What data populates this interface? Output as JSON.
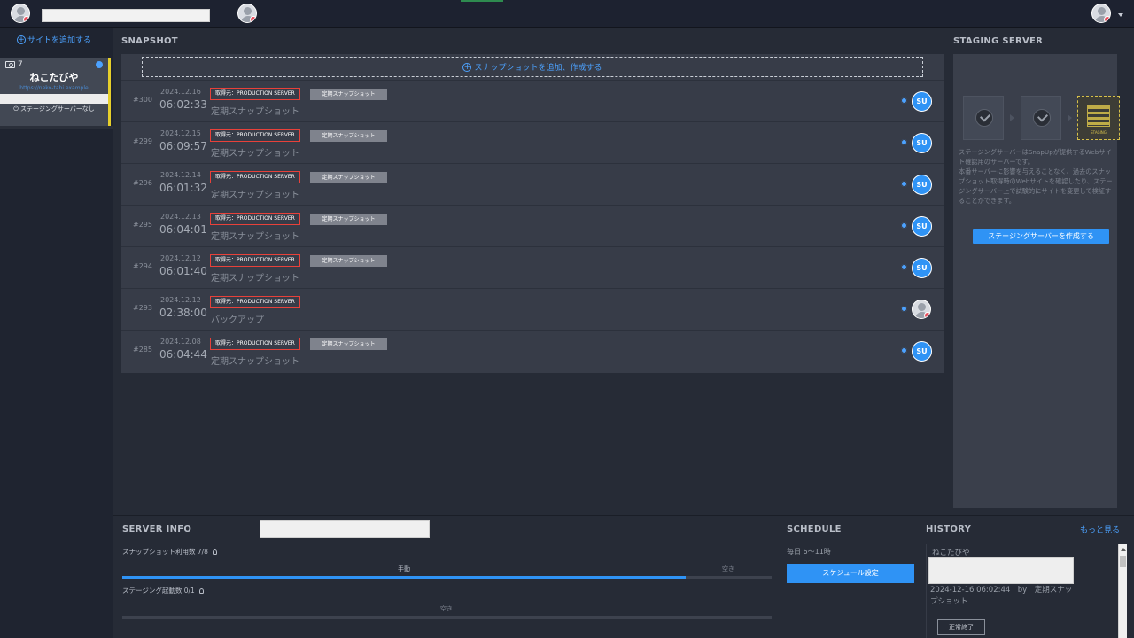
{
  "sidebar": {
    "add_site_label": "サイトを追加する",
    "site": {
      "count": "7",
      "name": "ねこたびや",
      "url": "https://neko-tabi.example",
      "staging_status": "ステージングサーバーなし"
    }
  },
  "snapshot": {
    "title": "SNAPSHOT",
    "add_label": "スナップショットを追加、作成する",
    "rows": [
      {
        "num": "#300",
        "date": "2024.12.16",
        "time": "06:02:33",
        "source": "取得元：PRODUCTION SERVER",
        "type": "定期スナップショット",
        "label": "定期スナップショット",
        "badge": "SU"
      },
      {
        "num": "#299",
        "date": "2024.12.15",
        "time": "06:09:57",
        "source": "取得元：PRODUCTION SERVER",
        "type": "定期スナップショット",
        "label": "定期スナップショット",
        "badge": "SU"
      },
      {
        "num": "#296",
        "date": "2024.12.14",
        "time": "06:01:32",
        "source": "取得元：PRODUCTION SERVER",
        "type": "定期スナップショット",
        "label": "定期スナップショット",
        "badge": "SU"
      },
      {
        "num": "#295",
        "date": "2024.12.13",
        "time": "06:04:01",
        "source": "取得元：PRODUCTION SERVER",
        "type": "定期スナップショット",
        "label": "定期スナップショット",
        "badge": "SU"
      },
      {
        "num": "#294",
        "date": "2024.12.12",
        "time": "06:01:40",
        "source": "取得元：PRODUCTION SERVER",
        "type": "定期スナップショット",
        "label": "定期スナップショット",
        "badge": "SU"
      },
      {
        "num": "#293",
        "date": "2024.12.12",
        "time": "02:38:00",
        "source": "取得元：PRODUCTION SERVER",
        "type": "",
        "label": "バックアップ",
        "badge": ""
      },
      {
        "num": "#285",
        "date": "2024.12.08",
        "time": "06:04:44",
        "source": "取得元：PRODUCTION SERVER",
        "type": "定期スナップショット",
        "label": "定期スナップショット",
        "badge": "SU"
      }
    ]
  },
  "staging": {
    "title": "STAGING SERVER",
    "icon_label": "STAGING",
    "desc_1": "ステージングサーバーはSnapUpが提供するWebサイト確認用のサーバーです。",
    "desc_2": "本番サーバーに影響を与えることなく、過去のスナップショット取得時のWebサイトを確認したり、ステージングサーバー上で試験的にサイトを変更して検証することができます。",
    "create_button": "ステージングサーバーを作成する"
  },
  "server_info": {
    "title": "SERVER INFO",
    "snapshot_usage_label": "スナップショット利用数 7/8",
    "snapshot_used_text": "手動",
    "snapshot_free_text": "空き",
    "snapshot_usage_fraction": 0.868,
    "staging_usage_label": "ステージング起動数 0/1",
    "staging_free_text": "空き"
  },
  "schedule": {
    "title": "SCHEDULE",
    "text": "毎日 6～11時",
    "button": "スケジュール設定"
  },
  "history": {
    "title": "HISTORY",
    "more_label": "もっと見る",
    "site": "ねこたびや",
    "entry": "2024-12-16 06:02:44　by　定期スナップショット",
    "status": "正常終了"
  },
  "colors": {
    "accent": "#2f93f5",
    "source_tag_border": "#e8413a",
    "selected_site_bar": "#e6cf2b"
  }
}
